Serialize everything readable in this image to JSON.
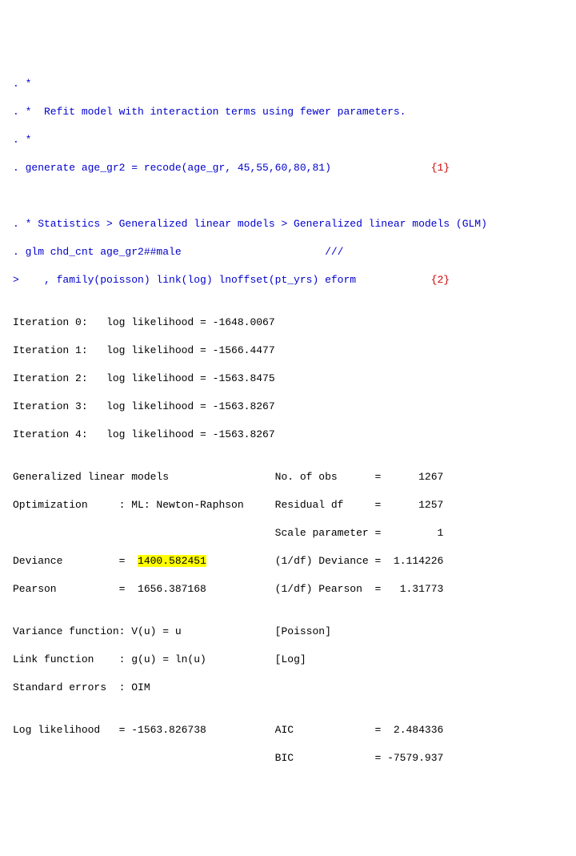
{
  "cmd": {
    "c1": ". *",
    "c2": ". *  Refit model with interaction terms using fewer parameters.",
    "c3": ". *",
    "c4a": ". generate age_gr2 = recode(age_gr, 45,55,60,80,81)",
    "c4b": "{1}",
    "blank1": "",
    "c5": ". * Statistics > Generalized linear models > Generalized linear models (GLM)",
    "c6a": ". glm chd_cnt age_gr2##male",
    "c6b": "///",
    "c7a": ">    , family(poisson) link(log) lnoffset(pt_yrs) eform",
    "c7b": "{2}"
  },
  "iter": {
    "i0": "Iteration 0:   log likelihood = -1648.0067",
    "i1": "Iteration 1:   log likelihood = -1566.4477",
    "i2": "Iteration 2:   log likelihood = -1563.8475",
    "i3": "Iteration 3:   log likelihood = -1563.8267",
    "i4": "Iteration 4:   log likelihood = -1563.8267"
  },
  "blk": {
    "l1a": "Generalized linear models",
    "l1b": "No. of obs      =      1267",
    "l2a": "Optimization     : ML: Newton-Raphson",
    "l2b": "Residual df     =      1257",
    "l3a": "                                          ",
    "l3b": "Scale parameter =         1",
    "l4a": "Deviance         =  ",
    "l4h": "1400.582451",
    "l4b": "(1/df) Deviance =  1.114226",
    "l5a": "Pearson          =  1656.387168",
    "l5b": "(1/df) Pearson  =   1.31773",
    "l6a": "Variance function: V(u) = u",
    "l6b": "[Poisson]",
    "l7a": "Link function    : g(u) = ln(u)",
    "l7b": "[Log]",
    "l8": "Standard errors  : OIM",
    "l9a": "Log likelihood   = -1563.826738",
    "l9b": "AIC             =  2.484336",
    "l10a": "                                          ",
    "l10b": "BIC             = -7579.937"
  },
  "col2start": 42
}
